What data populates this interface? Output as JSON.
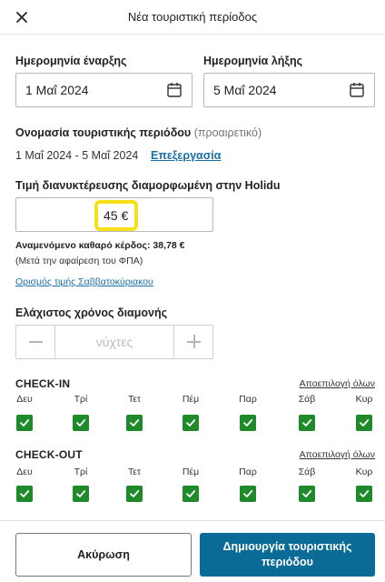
{
  "header": {
    "title": "Νέα τουριστική περίοδος",
    "close_icon": "close-icon"
  },
  "dates": {
    "start_label": "Ημερομηνία έναρξης",
    "start_value": "1 Μαΐ 2024",
    "end_label": "Ημερομηνία λήξης",
    "end_value": "5 Μαΐ 2024",
    "icon": "calendar-icon"
  },
  "season_name": {
    "label": "Ονομασία τουριστικής περιόδου",
    "optional": "(προαιρετικό)",
    "value": "1 Μαΐ 2024 - 5 Μαΐ 2024",
    "edit_link": "Επεξεργασία"
  },
  "price": {
    "label": "Τιμή διανυκτέρευσης διαμορφωμένη στην Holidu",
    "value": "45 €",
    "expected_profit": "Αναμενόμενο καθαρό κέρδος: 38,78 €",
    "note": "(Μετά την αφαίρεση του ΦΠΑ)",
    "weekend_link": "Ορισμός τιμής Σαββατοκύριακου",
    "highlight_color": "#f7e018"
  },
  "min_stay": {
    "label": "Ελάχιστος χρόνος διαμονής",
    "placeholder": "νύχτες",
    "minus_icon": "minus-icon",
    "plus_icon": "plus-icon"
  },
  "checkin": {
    "title": "CHECK-IN",
    "select_all": "Αποεπιλογή όλων",
    "days": [
      {
        "label": "Δευ",
        "checked": true
      },
      {
        "label": "Τρί",
        "checked": true
      },
      {
        "label": "Τετ",
        "checked": true
      },
      {
        "label": "Πέμ",
        "checked": true
      },
      {
        "label": "Παρ",
        "checked": true
      },
      {
        "label": "Σάβ",
        "checked": true
      },
      {
        "label": "Κυρ",
        "checked": true
      }
    ]
  },
  "checkout": {
    "title": "CHECK-OUT",
    "select_all": "Αποεπιλογή όλων",
    "days": [
      {
        "label": "Δευ",
        "checked": true
      },
      {
        "label": "Τρί",
        "checked": true
      },
      {
        "label": "Τετ",
        "checked": true
      },
      {
        "label": "Πέμ",
        "checked": true
      },
      {
        "label": "Παρ",
        "checked": true
      },
      {
        "label": "Σάβ",
        "checked": true
      },
      {
        "label": "Κυρ",
        "checked": true
      }
    ]
  },
  "footer": {
    "cancel": "Ακύρωση",
    "create": "Δημιουργία τουριστικής περιόδου"
  },
  "colors": {
    "accent": "#0a6b96",
    "checkbox": "#1e8a2a",
    "link": "#1a6fa3"
  }
}
